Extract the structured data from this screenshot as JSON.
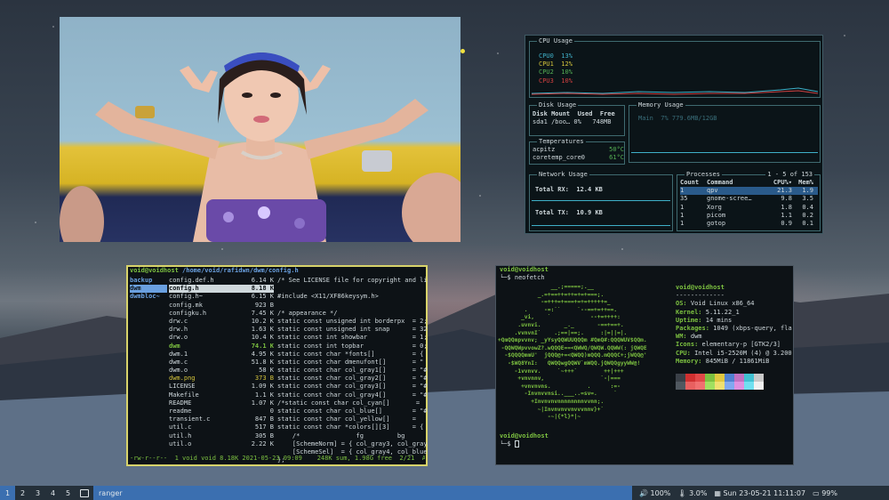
{
  "ranger": {
    "title_user": "void@voidhost",
    "title_path": "/home/void/rafidwn/dwm/config.h",
    "parent_dirs": [
      "backup",
      "dwm",
      "dwmbloc~"
    ],
    "files": [
      {
        "name": "config.def.h",
        "size": "6.14 K"
      },
      {
        "name": "config.h",
        "size": "8.18 K"
      },
      {
        "name": "config.h~",
        "size": "6.15 K"
      },
      {
        "name": "config.mk",
        "size": "923 B"
      },
      {
        "name": "configku.h",
        "size": "7.45 K"
      },
      {
        "name": "drw.c",
        "size": "10.2 K"
      },
      {
        "name": "drw.h",
        "size": "1.63 K"
      },
      {
        "name": "drw.o",
        "size": "10.4 K"
      },
      {
        "name": "dwm",
        "size": "74.1 K"
      },
      {
        "name": "dwm.1",
        "size": "4.95 K"
      },
      {
        "name": "dwm.c",
        "size": "51.8 K"
      },
      {
        "name": "dwm.o",
        "size": "58 K"
      },
      {
        "name": "dwm.png",
        "size": "373 B"
      },
      {
        "name": "LICENSE",
        "size": "1.09 K"
      },
      {
        "name": "Makefile",
        "size": "1.1 K"
      },
      {
        "name": "README",
        "size": "1.07 K"
      },
      {
        "name": "readme",
        "size": "0"
      },
      {
        "name": "transient.c",
        "size": "847 B"
      },
      {
        "name": "util.c",
        "size": "517 B"
      },
      {
        "name": "util.h",
        "size": "305 B"
      },
      {
        "name": "util.o",
        "size": "2.22 K"
      }
    ],
    "preview": [
      "/* See LICENSE file for copyright and li",
      "",
      "#include <X11/XF86keysym.h>",
      "",
      "/* appearance */",
      "static const unsigned int borderpx  = 2;",
      "static const unsigned int snap      = 32",
      "static const int showbar            = 1;",
      "static const int topbar             = 0;",
      "static const char *fonts[]          = {",
      "static const char dmenufont[]       = \"",
      "static const char col_gray1[]       = \"#",
      "static const char col_gray2[]       = \"#",
      "static const char col_gray3[]       = \"#",
      "static const char col_gray4[]       = \"#",
      "/*static const char col_cyan[]       =",
      "static const char col_blue[]        = \"#",
      "static const char col_yellow[]      =",
      "static const char *colors[][3]      = {",
      "    /*               fg         bg",
      "    [SchemeNorm] = { col_gray3, col_gray",
      "    [SchemeSel]  = { col_gray4, col_blue",
      "};"
    ],
    "status": "-rw-r--r--  1 void void 8.18K 2021-05-23 09:09    248K sum, 1.98G free  2/21  All"
  },
  "gotop": {
    "cpu_title": "CPU Usage",
    "cpus": [
      {
        "name": "CPU0",
        "val": "13%",
        "color": "#3fb0c8"
      },
      {
        "name": "CPU1",
        "val": "12%",
        "color": "#d4c43c"
      },
      {
        "name": "CPU2",
        "val": "10%",
        "color": "#55b055"
      },
      {
        "name": "CPU3",
        "val": "10%",
        "color": "#d04040"
      }
    ],
    "disk_title": "Disk Usage",
    "disk_headers": [
      "Disk",
      "Mount",
      "Used",
      "Free"
    ],
    "disk_row": [
      "sda1",
      "/boo…",
      "0%",
      "748MB"
    ],
    "mem_title": "Memory Usage",
    "mem_line": "Main  7% 779.6MB/12GB",
    "temp_title": "Temperatures",
    "temps": [
      {
        "name": "acpitz",
        "val": "50°C"
      },
      {
        "name": "coretemp_core0",
        "val": "61°C"
      }
    ],
    "net_title": "Network Usage",
    "rx_label": "Total RX:",
    "rx_val": "12.4 KB",
    "tx_label": "Total TX:",
    "tx_val": "10.9 KB",
    "proc_title": "Processes",
    "proc_range": "1 - 5 of 153",
    "proc_headers": [
      "Count",
      "Command",
      "CPU%▾",
      "Mem%"
    ],
    "procs": [
      [
        "1",
        "qpv",
        "21.3",
        "1.9"
      ],
      [
        "35",
        "gnome-scree…",
        "9.8",
        "3.5"
      ],
      [
        "1",
        "Xorg",
        "1.8",
        "0.4"
      ],
      [
        "1",
        "picom",
        "1.1",
        "0.2"
      ],
      [
        "1",
        "gotop",
        "0.9",
        "0.1"
      ]
    ]
  },
  "neofetch": {
    "prompt_user": "void@voidhost",
    "cmd": "neofetch",
    "user_host": "void@voidhost",
    "separator": "-------------",
    "info": [
      {
        "k": "OS:",
        "v": " Void Linux x86_64"
      },
      {
        "k": "Kernel:",
        "v": " 5.11.22_1"
      },
      {
        "k": "Uptime:",
        "v": " 14 mins"
      },
      {
        "k": "Packages:",
        "v": " 1049 (xbps-query, fla"
      },
      {
        "k": "WM:",
        "v": " dwm"
      },
      {
        "k": "Icons:",
        "v": " elementary-p [GTK2/3]"
      },
      {
        "k": "CPU:",
        "v": " Intel i5-2520M (4) @ 3.200"
      },
      {
        "k": "Memory:",
        "v": " 845MiB / 11861MiB"
      }
    ],
    "logo": [
      "                __.;=====;.__",
      "            _.=+==++=++=+=+===;.",
      "             -=+++=+===+=+=+++++=_",
      "        .     -=:``     `--==+=++==.",
      "       _vi,    `            --+=++++:",
      "      .uvnvi.       _._       -==+==+.",
      "     .vvnvnI`    .;==|==;.     :|=||=|.",
      "+QmQQmpvvnv; _yYsyQQWUUQQQm #QmQ#:QQQWUV$QQm.",
      " -QQWQWpvvowZ?.wQQQE==<QWWQ/QWQW.QQWW(: jQWQE",
      "  -$QQQQmmU'  jQQQ@+=<QWQQ)mQQQ.mQQQC+;jWQQ@'",
      "   -$WQ8YnI:   QWQQwgQQWV`mWQQ.jQWQQgyyWW@!",
      "     -1vvnvv.     `~+++`        ++|+++",
      "      +vnvnnv,                 `-|===",
      "       +vnvnvns.           .      :=-",
      "        -Invnvvnsi..___..=sv=.     `",
      "          +Invnvnvnnnnnnnnvvnn;.",
      "            ~|Invnvnvvnvvvnnv}+`",
      "               -~|{*l}*|~"
    ],
    "palette": [
      "#3a4048",
      "#d03030",
      "#e04848",
      "#7cc040",
      "#e0c840",
      "#5080d0",
      "#c070c0",
      "#40c0d0",
      "#c8c8c8"
    ],
    "palette2": [
      "#505860",
      "#e86060",
      "#f07070",
      "#a0e060",
      "#f0e070",
      "#80a8f0",
      "#e090e0",
      "#70e0f0",
      "#f0f0f0"
    ],
    "prompt2_user": "void@voidhost"
  },
  "taskbar": {
    "workspaces": [
      "1",
      "2",
      "3",
      "4",
      "5"
    ],
    "active_workspace": "1",
    "window_title": "ranger",
    "volume": "100%",
    "temp_icon_val": "3.0%",
    "datetime": "Sun 23-05-21 11:11:07",
    "battery": "99%"
  }
}
